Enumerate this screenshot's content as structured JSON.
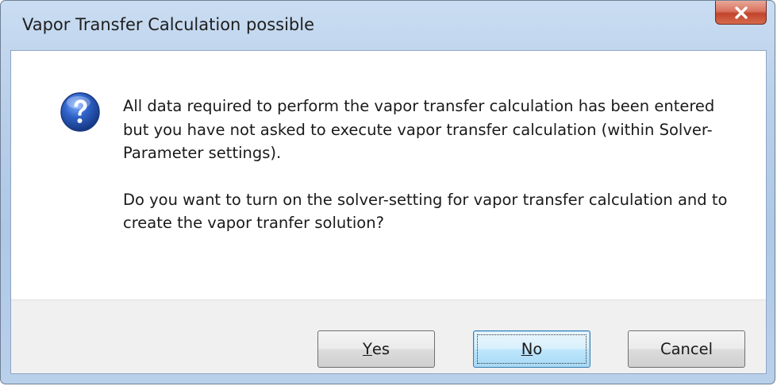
{
  "window": {
    "title": "Vapor Transfer Calculation possible",
    "close_icon": "close-icon"
  },
  "icon": "question-icon",
  "message": {
    "line1": "All data required to perform the vapor transfer calculation has been entered",
    "line2": "but you have not asked to execute vapor transfer calculation (within Solver-Parameter settings).",
    "line3": "Do you want to turn on the solver-setting for vapor transfer calculation and to create the vapor tranfer solution?"
  },
  "buttons": {
    "yes": {
      "key": "Y",
      "rest": "es"
    },
    "no": {
      "key": "N",
      "rest": "o"
    },
    "cancel": "Cancel"
  },
  "colors": {
    "title_bar": "#b8cfe9",
    "close_button": "#c2442c",
    "icon_blue": "#1f4fa8"
  }
}
